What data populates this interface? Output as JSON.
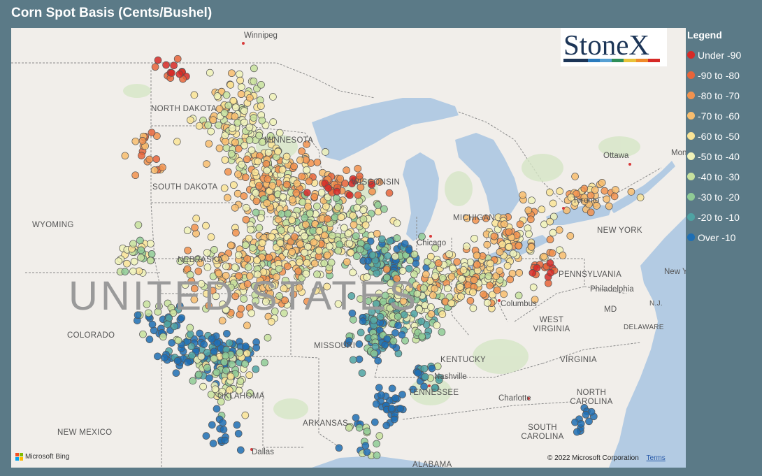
{
  "title": "Corn Spot Basis (Cents/Bushel)",
  "legend": {
    "title": "Legend",
    "items": [
      {
        "label": "Under -90",
        "color": "#d62a27"
      },
      {
        "label": "-90 to -80",
        "color": "#e8643a"
      },
      {
        "label": "-80 to -70",
        "color": "#f2924e"
      },
      {
        "label": "-70 to -60",
        "color": "#f8bd6e"
      },
      {
        "label": "-60 to -50",
        "color": "#fae496"
      },
      {
        "label": "-50 to -40",
        "color": "#f0f2b8"
      },
      {
        "label": "-40 to -30",
        "color": "#c8e29e"
      },
      {
        "label": "-30 to -20",
        "color": "#8fcb95"
      },
      {
        "label": "-20 to -10",
        "color": "#4fa3a3"
      },
      {
        "label": "Over -10",
        "color": "#1f6fb4"
      }
    ]
  },
  "logo": {
    "text": "StoneX",
    "bar_colors": [
      "#1c3557",
      "#1c3557",
      "#2b7bbd",
      "#57a0d3",
      "#2f8f5a",
      "#e8c33a",
      "#f08a2a",
      "#d62a27"
    ]
  },
  "map_labels": {
    "states": [
      "NORTH DAKOTA",
      "SOUTH DAKOTA",
      "MINNESOTA",
      "WYOMING",
      "NEBRASKA",
      "COLORADO",
      "MISSOURI",
      "OKLAHOMA",
      "ARKANSAS",
      "NEW MEXICO",
      "TENNESSEE",
      "KENTUCKY",
      "WEST VIRGINIA",
      "VIRGINIA",
      "NORTH CAROLINA",
      "SOUTH CAROLINA",
      "PENNSYLVANIA",
      "NEW YORK",
      "MD",
      "DELAWARE",
      "N.J.",
      "ALABAMA",
      "WISCONSIN",
      "MICHIGAN"
    ],
    "cities": [
      "Winnipeg",
      "Ottawa",
      "Chicago",
      "Columbus",
      "Philadelphia",
      "Nashville",
      "Charlotte",
      "Dallas",
      "Toronto",
      "New York",
      "Montreal"
    ],
    "country": "UNITED STATES"
  },
  "attribution": {
    "bing": "Microsoft Bing",
    "copyright": "© 2022 Microsoft Corporation",
    "terms": "Terms"
  }
}
